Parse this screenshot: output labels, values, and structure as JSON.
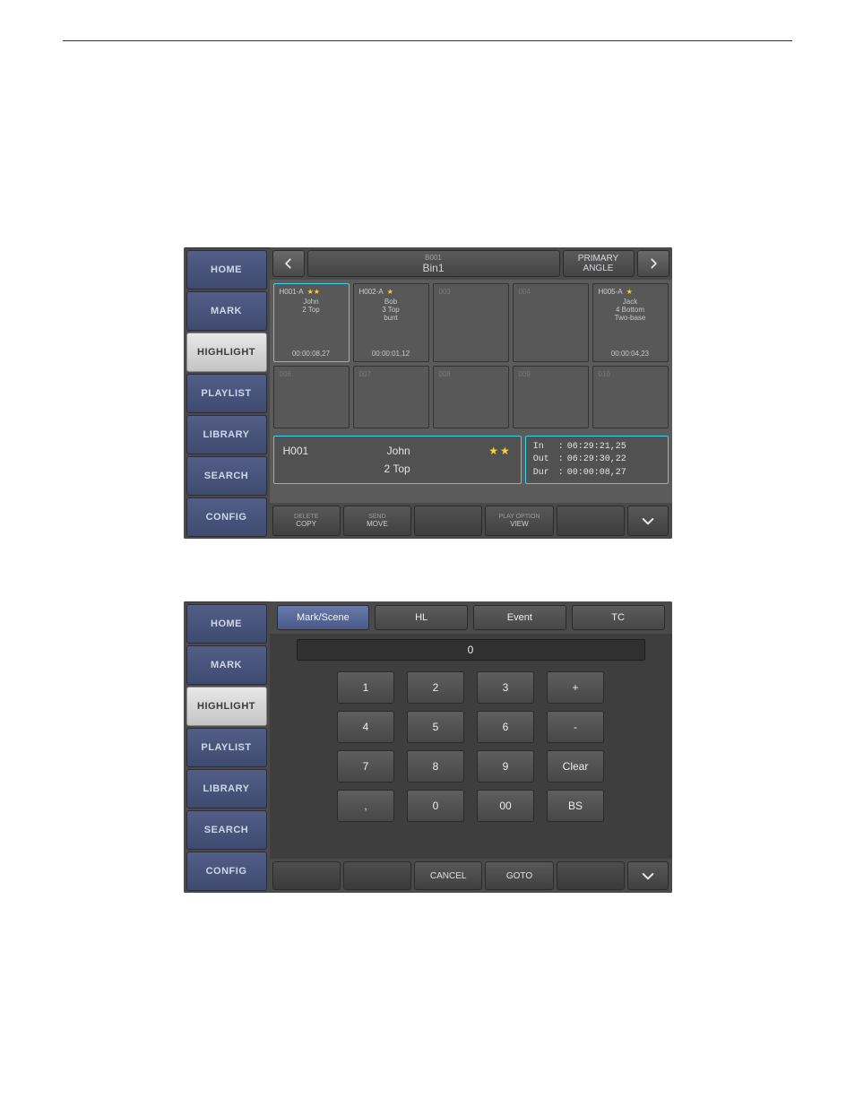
{
  "nav": {
    "items": [
      "HOME",
      "MARK",
      "HIGHLIGHT",
      "PLAYLIST",
      "LIBRARY",
      "SEARCH",
      "CONFIG"
    ],
    "active_index": 2
  },
  "panel1": {
    "header": {
      "bin_id": "B001",
      "bin_name": "Bin1",
      "right_label": "PRIMARY\nANGLE"
    },
    "clips": [
      {
        "slot": "H001-A",
        "stars": "★★",
        "name": "John",
        "tags": [
          "2 Top"
        ],
        "tc": "00:00:08,27",
        "selected": true
      },
      {
        "slot": "H002-A",
        "stars": "★",
        "name": "Bob",
        "tags": [
          "3 Top",
          "bunt"
        ],
        "tc": "00:00:01,12"
      },
      {
        "slot": "003"
      },
      {
        "slot": "004"
      },
      {
        "slot": "H005-A",
        "stars": "★",
        "name": "Jack",
        "tags": [
          "4 Bottom",
          "Two-base"
        ],
        "tc": "00:00:04,23"
      },
      {
        "slot": "006"
      },
      {
        "slot": "007"
      },
      {
        "slot": "008"
      },
      {
        "slot": "009"
      },
      {
        "slot": "010"
      }
    ],
    "detail": {
      "id": "H001",
      "name": "John",
      "stars": "★★",
      "tag": "2 Top",
      "in": "06:29:21,25",
      "out": "06:29:30,22",
      "dur": "00:00:08,27",
      "labels": {
        "in": "In",
        "out": "Out",
        "dur": "Dur"
      }
    },
    "footer": [
      {
        "top": "DELETE",
        "bottom": "COPY"
      },
      {
        "top": "SEND",
        "bottom": "MOVE"
      },
      {
        "blank": true
      },
      {
        "top": "PLAY OPTION",
        "bottom": "VIEW"
      },
      {
        "blank": true
      },
      {
        "chevron": true
      }
    ]
  },
  "panel2": {
    "tabs": [
      "Mark/Scene",
      "HL",
      "Event",
      "TC"
    ],
    "active_tab": 0,
    "display": "0",
    "keys": [
      [
        "1",
        "2",
        "3",
        "+"
      ],
      [
        "4",
        "5",
        "6",
        "-"
      ],
      [
        "7",
        "8",
        "9",
        "Clear"
      ],
      [
        ",",
        "0",
        "00",
        "BS"
      ]
    ],
    "footer": [
      "",
      "",
      "CANCEL",
      "GOTO",
      "",
      "chev"
    ]
  }
}
